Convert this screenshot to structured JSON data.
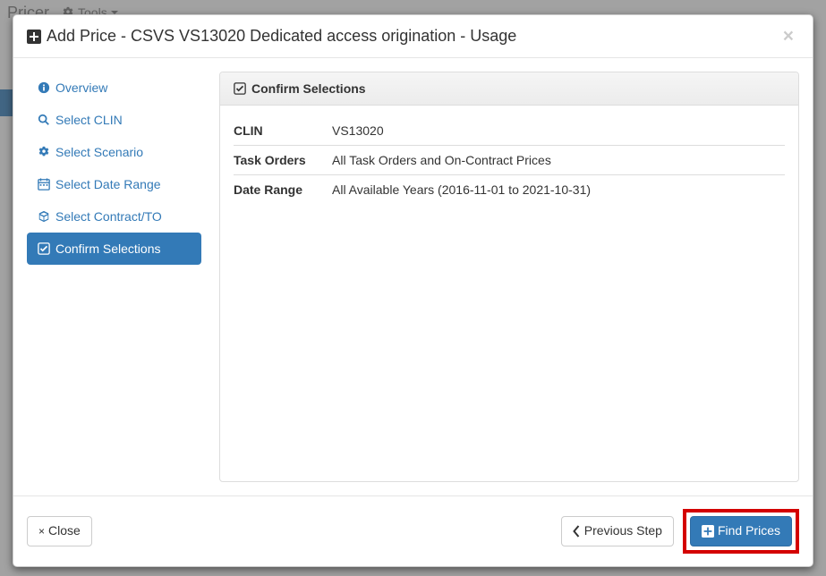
{
  "background": {
    "brand": "Pricer",
    "tools_label": "Tools"
  },
  "modal": {
    "title": "Add Price - CSVS VS13020 Dedicated access origination - Usage",
    "close_glyph": "×"
  },
  "sidebar": {
    "items": [
      {
        "label": "Overview",
        "icon": "info"
      },
      {
        "label": "Select CLIN",
        "icon": "search"
      },
      {
        "label": "Select Scenario",
        "icon": "cogs"
      },
      {
        "label": "Select Date Range",
        "icon": "calendar"
      },
      {
        "label": "Select Contract/TO",
        "icon": "cube"
      },
      {
        "label": "Confirm Selections",
        "icon": "check"
      }
    ],
    "active_index": 5
  },
  "panel": {
    "heading": "Confirm Selections",
    "rows": [
      {
        "label": "CLIN",
        "value": "VS13020"
      },
      {
        "label": "Task Orders",
        "value": "All Task Orders and On-Contract Prices"
      },
      {
        "label": "Date Range",
        "value": "All Available Years (2016-11-01 to 2021-10-31)"
      }
    ]
  },
  "footer": {
    "close_label": "Close",
    "previous_label": "Previous Step",
    "find_label": "Find Prices"
  }
}
